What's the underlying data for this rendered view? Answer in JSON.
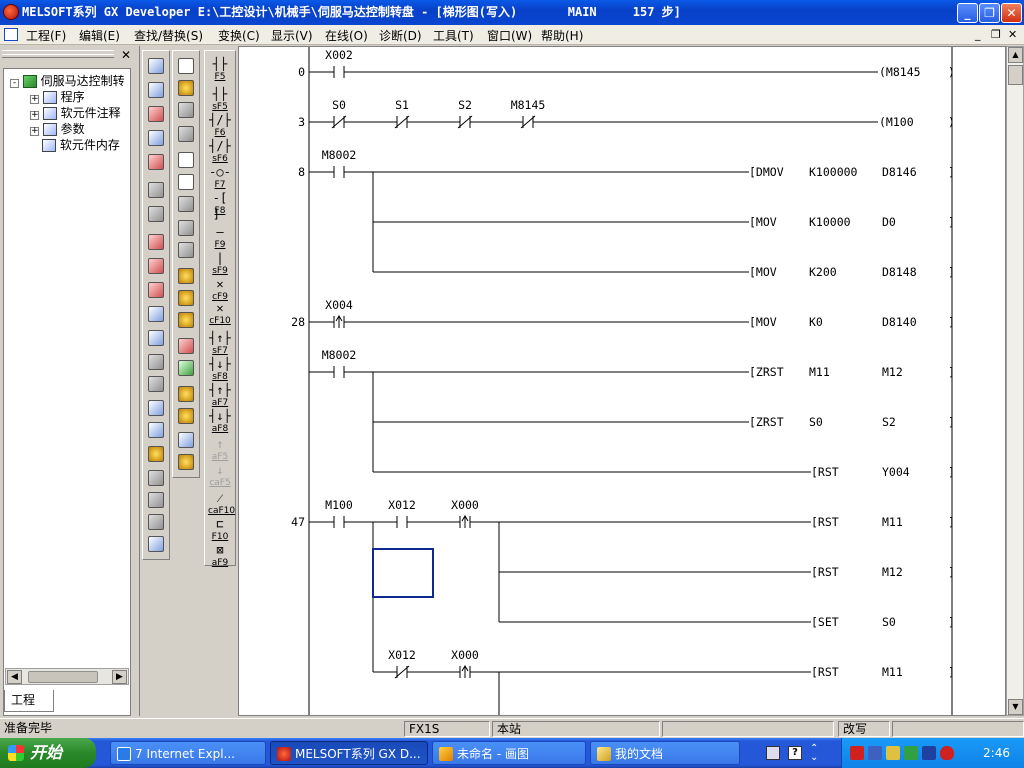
{
  "window": {
    "title": "MELSOFT系列 GX Developer E:\\工控设计\\机械手\\伺服马达控制转盘 - [梯形图(写入)       MAIN     157 步]",
    "controls": [
      "_",
      "❐",
      "✕"
    ]
  },
  "menu": {
    "items": [
      "工程(F)",
      "编辑(E)",
      "查找/替换(S)",
      "变换(C)",
      "显示(V)",
      "在线(O)",
      "诊断(D)",
      "工具(T)",
      "窗口(W)",
      "帮助(H)"
    ],
    "doc_controls": [
      "_",
      "❐",
      "✕"
    ]
  },
  "project_panel": {
    "close": "✕",
    "tree": [
      {
        "label": "伺服马达控制转",
        "level": 0,
        "expander": "-",
        "icon": "project-icon"
      },
      {
        "label": "程序",
        "level": 1,
        "expander": "+",
        "icon": "program-icon"
      },
      {
        "label": "软元件注释",
        "level": 1,
        "expander": "+",
        "icon": "comment-icon"
      },
      {
        "label": "参数",
        "level": 1,
        "expander": "+",
        "icon": "parameter-icon"
      },
      {
        "label": "软元件内存",
        "level": 1,
        "expander": "",
        "icon": "device-memory-icon"
      }
    ],
    "tab": "工程"
  },
  "function_keys": [
    {
      "sym": "┤├",
      "label": "F5",
      "enabled": true
    },
    {
      "sym": "┤├",
      "label": "sF5",
      "enabled": true
    },
    {
      "sym": "┤/├",
      "label": "F6",
      "enabled": true
    },
    {
      "sym": "┤/├",
      "label": "sF6",
      "enabled": true
    },
    {
      "sym": "-○-",
      "label": "F7",
      "enabled": true
    },
    {
      "sym": "-[ ]-",
      "label": "F8",
      "enabled": true
    },
    {
      "sym": "—",
      "label": "F9",
      "enabled": true
    },
    {
      "sym": "|",
      "label": "sF9",
      "enabled": true
    },
    {
      "sym": "✕",
      "label": "cF9",
      "enabled": true
    },
    {
      "sym": "✕",
      "label": "cF10",
      "enabled": true
    },
    {
      "sym": "┤↑├",
      "label": "sF7",
      "enabled": true
    },
    {
      "sym": "┤↓├",
      "label": "sF8",
      "enabled": true
    },
    {
      "sym": "┤↑├",
      "label": "aF7",
      "enabled": true
    },
    {
      "sym": "┤↓├",
      "label": "aF8",
      "enabled": true
    },
    {
      "sym": "↑",
      "label": "aF5",
      "enabled": false
    },
    {
      "sym": "↓",
      "label": "caF5",
      "enabled": false
    },
    {
      "sym": "⁄",
      "label": "caF10",
      "enabled": true
    },
    {
      "sym": "⊏",
      "label": "F10",
      "enabled": true
    },
    {
      "sym": "⊠",
      "label": "aF9",
      "enabled": true
    }
  ],
  "ladder": {
    "rungs": [
      {
        "step": "0",
        "contacts": [
          {
            "name": "X002",
            "type": "NO"
          }
        ],
        "coil": "M8145"
      },
      {
        "step": "3",
        "contacts": [
          {
            "name": "S0",
            "type": "NC"
          },
          {
            "name": "S1",
            "type": "NC"
          },
          {
            "name": "S2",
            "type": "NC"
          },
          {
            "name": "M8145",
            "type": "NC"
          }
        ],
        "coil": "M100"
      },
      {
        "step": "8",
        "contacts": [
          {
            "name": "M8002",
            "type": "NO"
          }
        ],
        "instructions": [
          [
            "DMOV",
            "K100000",
            "D8146"
          ],
          [
            "MOV",
            "K10000",
            "D0"
          ],
          [
            "MOV",
            "K200",
            "D8148"
          ]
        ]
      },
      {
        "step": "28",
        "contacts": [
          {
            "name": "X004",
            "type": "P"
          }
        ],
        "instructions": [
          [
            "MOV",
            "K0",
            "D8140"
          ]
        ]
      },
      {
        "step": "",
        "contacts": [
          {
            "name": "M8002",
            "type": "NO"
          }
        ],
        "instructions": [
          [
            "ZRST",
            "M11",
            "M12"
          ],
          [
            "ZRST",
            "S0",
            "S2"
          ],
          [
            "RST",
            "Y004",
            ""
          ]
        ]
      },
      {
        "step": "47",
        "contacts": [
          {
            "name": "M100",
            "type": "NO"
          },
          {
            "name": "X012",
            "type": "NO"
          },
          {
            "name": "X000",
            "type": "P"
          }
        ],
        "instructions": [
          [
            "RST",
            "M11",
            ""
          ],
          [
            "RST",
            "M12",
            ""
          ],
          [
            "SET",
            "S0",
            ""
          ]
        ]
      },
      {
        "step": "",
        "contacts": [
          {
            "name": "X012",
            "type": "NC"
          },
          {
            "name": "X000",
            "type": "P"
          }
        ],
        "instructions": [
          [
            "RST",
            "M11",
            ""
          ]
        ]
      }
    ]
  },
  "status": {
    "ready": "准备完毕",
    "plc": "FX1S",
    "station": "本站",
    "mode": "改写"
  },
  "taskbar": {
    "start": "开始",
    "tasks": [
      {
        "label": "7 Internet Expl...",
        "active": false
      },
      {
        "label": "MELSOFT系列 GX D...",
        "active": true
      },
      {
        "label": "未命名 - 画图",
        "active": false
      },
      {
        "label": "我的文档",
        "active": false
      }
    ],
    "clock": "2:46"
  }
}
